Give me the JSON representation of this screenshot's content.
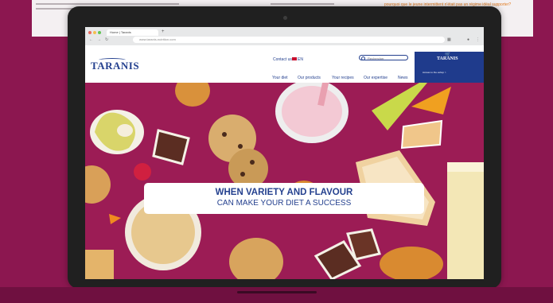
{
  "background_doc": {
    "heading": "pourquoi que le jeune intermittent n'était pas un régime idéal supporter?"
  },
  "browser": {
    "tab_label": "Home | Taranis",
    "new_tab": "+",
    "back": "←",
    "forward": "→",
    "reload": "↻",
    "url_placeholder": "www.taranis-nutrition.com"
  },
  "header": {
    "logo": "TARANIS",
    "contact": "Contact us",
    "language": "EN",
    "search_placeholder": "Rechercher",
    "menu": [
      "Your diet",
      "Our products",
      "Your recipes",
      "Our expertise",
      "News"
    ],
    "promo_logo": "TARANIS",
    "promo_text": "Access to the eshop >"
  },
  "hero": {
    "title": "WHEN VARIETY AND FLAVOUR",
    "subtitle": "CAN MAKE YOUR DIET A SUCCESS"
  },
  "colors": {
    "brand_blue": "#25418f",
    "hero_bg": "#9c1c55",
    "page_bg": "#8c1750"
  }
}
